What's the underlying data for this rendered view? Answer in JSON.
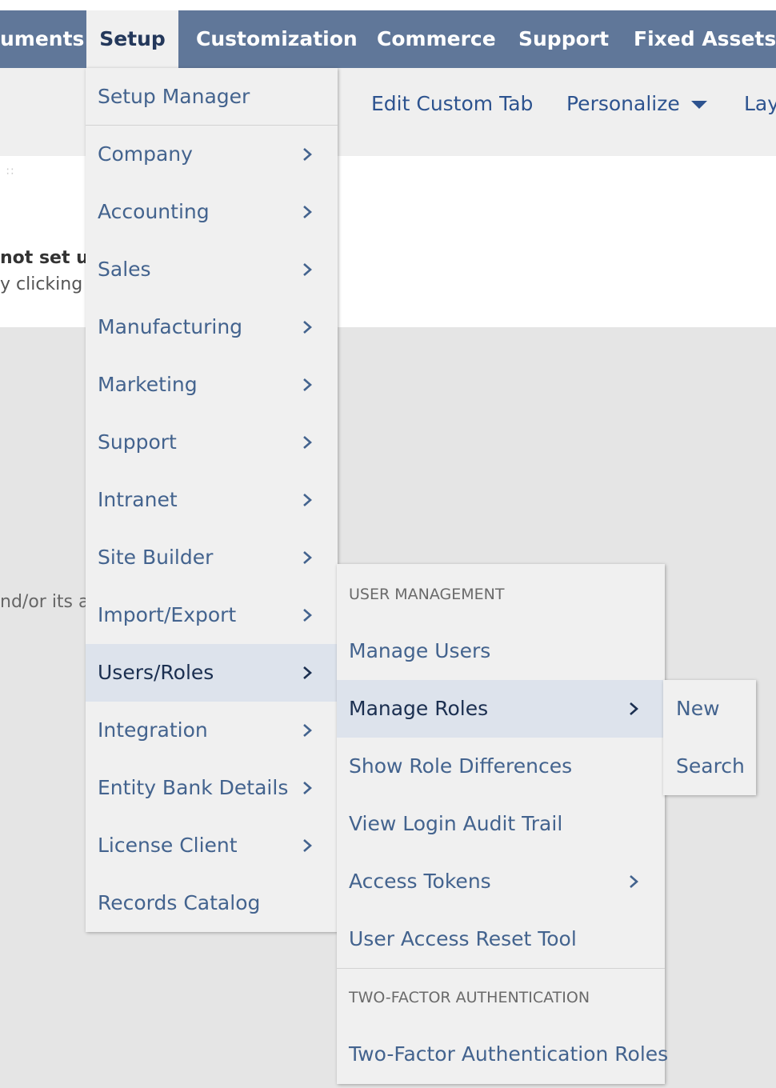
{
  "nav": {
    "items": [
      {
        "label": "uments"
      },
      {
        "label": "Setup"
      },
      {
        "label": "Customization"
      },
      {
        "label": "Commerce"
      },
      {
        "label": "Support"
      },
      {
        "label": "Fixed Assets"
      }
    ]
  },
  "subbar": {
    "edit_custom_tab": "Edit Custom Tab",
    "personalize": "Personalize",
    "layout_partial": "Lay"
  },
  "portlet": {
    "bold_text": "not set up",
    "sub_text": "y clicking o"
  },
  "footer_text": "nd/or its af",
  "setup_menu": {
    "items": [
      {
        "label": "Setup Manager"
      },
      {
        "label": "Company"
      },
      {
        "label": "Accounting"
      },
      {
        "label": "Sales"
      },
      {
        "label": "Manufacturing"
      },
      {
        "label": "Marketing"
      },
      {
        "label": "Support"
      },
      {
        "label": "Intranet"
      },
      {
        "label": "Site Builder"
      },
      {
        "label": "Import/Export"
      },
      {
        "label": "Users/Roles"
      },
      {
        "label": "Integration"
      },
      {
        "label": "Entity Bank Details"
      },
      {
        "label": "License Client"
      },
      {
        "label": "Records Catalog"
      }
    ]
  },
  "users_roles_menu": {
    "user_management_header": "USER MANAGEMENT",
    "items": [
      {
        "label": "Manage Users"
      },
      {
        "label": "Manage Roles"
      },
      {
        "label": "Show Role Differences"
      },
      {
        "label": "View Login Audit Trail"
      },
      {
        "label": "Access Tokens"
      },
      {
        "label": "User Access Reset Tool"
      }
    ],
    "two_factor_header": "TWO-FACTOR AUTHENTICATION",
    "two_factor_item": "Two-Factor Authentication Roles"
  },
  "manage_roles_menu": {
    "items": [
      {
        "label": "New"
      },
      {
        "label": "Search"
      }
    ]
  },
  "colors": {
    "nav_bg": "#607799",
    "menu_bg": "#f0f0f0",
    "menu_text": "#43638e",
    "active_bg": "#dde3ec",
    "link": "#2d538f"
  },
  "icons": [
    "chevron-right-icon",
    "caret-down-icon",
    "drag-handle-icon"
  ]
}
